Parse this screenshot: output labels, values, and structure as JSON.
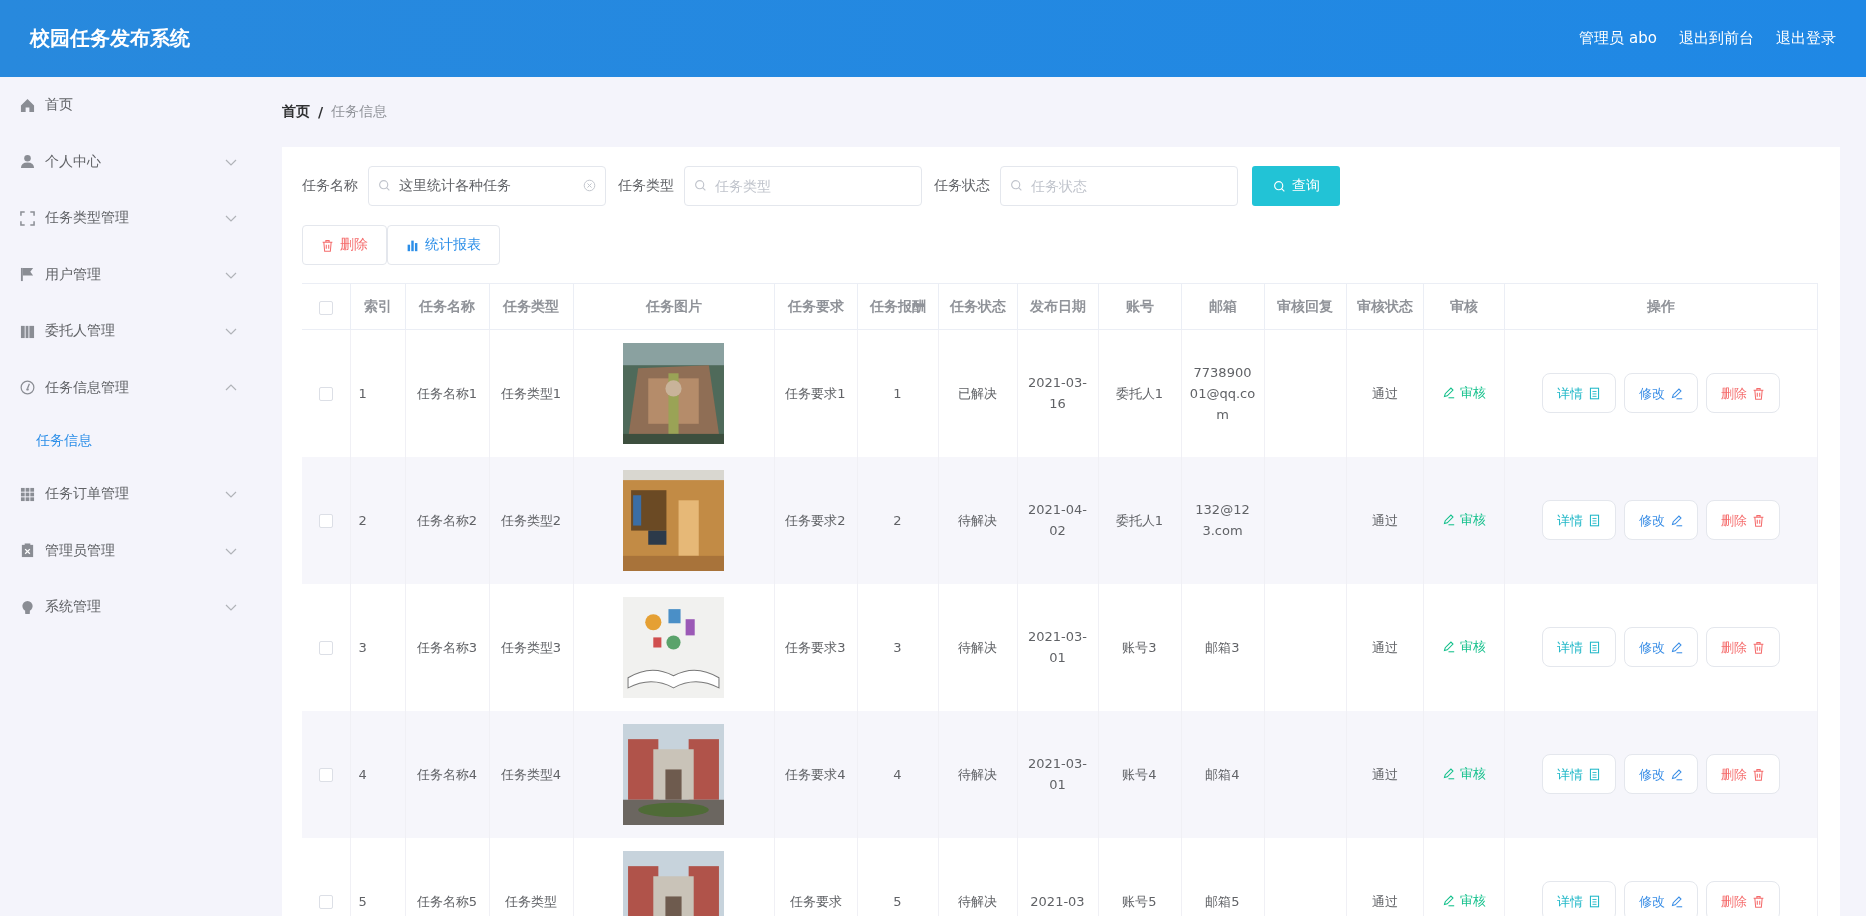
{
  "header": {
    "title": "校园任务发布系统",
    "links": [
      "管理员 abo",
      "退出到前台",
      "退出登录"
    ]
  },
  "sidebar": {
    "items": [
      {
        "label": "首页",
        "kind": "link"
      },
      {
        "label": "个人中心",
        "kind": "menu",
        "expanded": false
      },
      {
        "label": "任务类型管理",
        "kind": "menu",
        "expanded": false
      },
      {
        "label": "用户管理",
        "kind": "menu",
        "expanded": false
      },
      {
        "label": "委托人管理",
        "kind": "menu",
        "expanded": false
      },
      {
        "label": "任务信息管理",
        "kind": "menu",
        "expanded": true,
        "children": [
          {
            "label": "任务信息",
            "selected": true
          }
        ]
      },
      {
        "label": "任务订单管理",
        "kind": "menu",
        "expanded": false
      },
      {
        "label": "管理员管理",
        "kind": "menu",
        "expanded": false
      },
      {
        "label": "系统管理",
        "kind": "menu",
        "expanded": false
      }
    ]
  },
  "breadcrumb": {
    "items": [
      "首页",
      "任务信息"
    ],
    "separator": "/"
  },
  "search": {
    "fields": [
      {
        "label": "任务名称",
        "value": "这里统计各种任务",
        "clearable": true
      },
      {
        "label": "任务类型",
        "placeholder": "任务类型"
      },
      {
        "label": "任务状态",
        "placeholder": "任务状态"
      }
    ],
    "button": "查询"
  },
  "toolbar": [
    {
      "label": "删除",
      "kind": "delete"
    },
    {
      "label": "统计报表",
      "kind": "report"
    }
  ],
  "table": {
    "columns": [
      "索引",
      "任务名称",
      "任务类型",
      "任务图片",
      "任务要求",
      "任务报酬",
      "任务状态",
      "发布日期",
      "账号",
      "邮箱",
      "审核回复",
      "审核状态",
      "审核",
      "操作"
    ],
    "header_checked": false,
    "rows": [
      {
        "checked": false,
        "index": "1",
        "name": "任务名称1",
        "type": "任务类型1",
        "requirement": "任务要求1",
        "reward": "1",
        "status": "已解决",
        "date": "2021-03-16",
        "account": "委托人1",
        "email": "773890001@qq.com",
        "review_status": "通过",
        "review": "审核",
        "actions": [
          {
            "label": "详情",
            "kind": "detail"
          },
          {
            "label": "修改",
            "kind": "edit"
          },
          {
            "label": "删除",
            "kind": "delete"
          }
        ]
      },
      {
        "checked": false,
        "index": "2",
        "name": "任务名称2",
        "type": "任务类型2",
        "requirement": "任务要求2",
        "reward": "2",
        "status": "待解决",
        "date": "2021-04-02",
        "account": "委托人1",
        "email": "132@123.com",
        "review_status": "通过",
        "review": "审核",
        "actions": [
          {
            "label": "详情",
            "kind": "detail"
          },
          {
            "label": "修改",
            "kind": "edit"
          },
          {
            "label": "删除",
            "kind": "delete"
          }
        ]
      },
      {
        "checked": false,
        "index": "3",
        "name": "任务名称3",
        "type": "任务类型3",
        "requirement": "任务要求3",
        "reward": "3",
        "status": "待解决",
        "date": "2021-03-01",
        "account": "账号3",
        "email": "邮箱3",
        "review_status": "通过",
        "review": "审核",
        "actions": [
          {
            "label": "详情",
            "kind": "detail"
          },
          {
            "label": "修改",
            "kind": "edit"
          },
          {
            "label": "删除",
            "kind": "delete"
          }
        ]
      },
      {
        "checked": false,
        "index": "4",
        "name": "任务名称4",
        "type": "任务类型4",
        "requirement": "任务要求4",
        "reward": "4",
        "status": "待解决",
        "date": "2021-03-01",
        "account": "账号4",
        "email": "邮箱4",
        "review_status": "通过",
        "review": "审核",
        "actions": [
          {
            "label": "详情",
            "kind": "detail"
          },
          {
            "label": "修改",
            "kind": "edit"
          },
          {
            "label": "删除",
            "kind": "delete"
          }
        ]
      },
      {
        "checked": false,
        "index": "5",
        "name": "任务名称5",
        "type": "任务类型",
        "requirement": "任务要求",
        "reward": "5",
        "status": "待解决",
        "date": "2021-03",
        "account": "账号5",
        "email": "邮箱5",
        "review_status": "通过",
        "review": "审核",
        "actions": [
          {
            "label": "详情",
            "kind": "detail"
          },
          {
            "label": "修改",
            "kind": "edit"
          },
          {
            "label": "删除",
            "kind": "delete"
          }
        ]
      }
    ]
  }
}
